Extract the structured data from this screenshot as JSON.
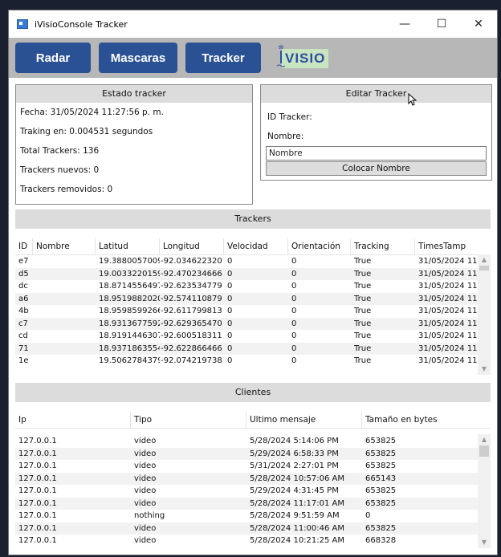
{
  "window": {
    "title": "iVisioConsole Tracker",
    "minimize": "—",
    "maximize": "☐",
    "close": "✕"
  },
  "toolbar": {
    "radar_label": "Radar",
    "mascaras_label": "Mascaras",
    "tracker_label": "Tracker",
    "logo_text": "VISIO"
  },
  "estado": {
    "header": "Estado tracker",
    "fecha": "Fecha: 31/05/2024 11:27:56 p. m.",
    "traking": "Traking en: 0.004531 segundos",
    "total": "Total Trackers: 136",
    "nuevos": "Trackers nuevos: 0",
    "removidos": "Trackers removidos: 0"
  },
  "editar": {
    "header": "Editar Tracker",
    "id_label": "ID Tracker:",
    "nombre_label": "Nombre:",
    "nombre_placeholder": "Nombre",
    "colocar_label": "Colocar Nombre"
  },
  "trackers": {
    "header": "Trackers",
    "columns": [
      "ID",
      "Nombre",
      "Latitud",
      "Longitud",
      "Velocidad",
      "Orientación",
      "Tracking",
      "TimesTamp"
    ],
    "rows": [
      [
        "e7",
        "",
        "19.3880057009",
        "-92.034622320",
        "0",
        "0",
        "True",
        "31/05/2024 11:"
      ],
      [
        "d5",
        "",
        "19.0033220159",
        "-92.470234666",
        "0",
        "0",
        "True",
        "31/05/2024 11:"
      ],
      [
        "dc",
        "",
        "18.8714556497",
        "-92.623534779",
        "0",
        "0",
        "True",
        "31/05/2024 11:"
      ],
      [
        "a6",
        "",
        "18.9519882020",
        "-92.574110879",
        "0",
        "0",
        "True",
        "31/05/2024 11:"
      ],
      [
        "4b",
        "",
        "18.9598599266",
        "-92.611799813",
        "0",
        "0",
        "True",
        "31/05/2024 11:"
      ],
      [
        "c7",
        "",
        "18.9313677592",
        "-92.629365470",
        "0",
        "0",
        "True",
        "31/05/2024 11:"
      ],
      [
        "cd",
        "",
        "18.9191446307",
        "-92.600518311",
        "0",
        "0",
        "True",
        "31/05/2024 11:"
      ],
      [
        "71",
        "",
        "18.9371863554",
        "-92.622866466",
        "0",
        "0",
        "True",
        "31/05/2024 11:"
      ],
      [
        "1e",
        "",
        "19.5062784379",
        "-92.074219738",
        "0",
        "0",
        "True",
        "31/05/2024 11:"
      ]
    ]
  },
  "clientes": {
    "header": "Clientes",
    "columns": [
      "Ip",
      "Tipo",
      "Ultimo mensaje",
      "Tamaño en bytes"
    ],
    "rows": [
      [
        "127.0.0.1",
        "video",
        "5/28/2024 5:14:06 PM",
        "653825"
      ],
      [
        "127.0.0.1",
        "video",
        "5/29/2024 6:58:33 PM",
        "653825"
      ],
      [
        "127.0.0.1",
        "video",
        "5/31/2024 2:27:01 PM",
        "653825"
      ],
      [
        "127.0.0.1",
        "video",
        "5/28/2024 10:57:06 AM",
        "665143"
      ],
      [
        "127.0.0.1",
        "video",
        "5/29/2024 4:31:45 PM",
        "653825"
      ],
      [
        "127.0.0.1",
        "video",
        "5/28/2024 11:17:01 AM",
        "653825"
      ],
      [
        "127.0.0.1",
        "nothing",
        "5/28/2024 9:51:59 AM",
        "0"
      ],
      [
        "127.0.0.1",
        "video",
        "5/28/2024 11:00:46 AM",
        "653825"
      ],
      [
        "127.0.0.1",
        "video",
        "5/28/2024 10:21:25 AM",
        "668328"
      ]
    ]
  },
  "colors": {
    "nav_button": "#2a5193",
    "toolbar": "#b7b7b7",
    "header": "#dcdcdc"
  }
}
